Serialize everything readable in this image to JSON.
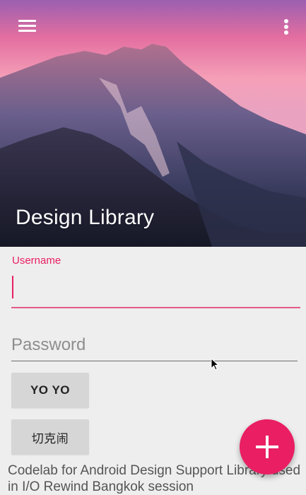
{
  "toolbar": {
    "title": "Design Library",
    "menu_icon": "hamburger-menu-icon",
    "overflow_icon": "more-vertical-icon"
  },
  "form": {
    "username_label": "Username",
    "username_value": "",
    "password_placeholder": "Password",
    "password_value": "",
    "button1_label": "YO YO",
    "button2_label": "切克闹"
  },
  "footer": {
    "text": "Codelab for Android Design Support Library used in I/O Rewind Bangkok session"
  },
  "fab": {
    "icon": "plus-icon"
  },
  "colors": {
    "accent": "#e91e63",
    "background": "#eeeeee",
    "button": "#d6d6d6"
  }
}
